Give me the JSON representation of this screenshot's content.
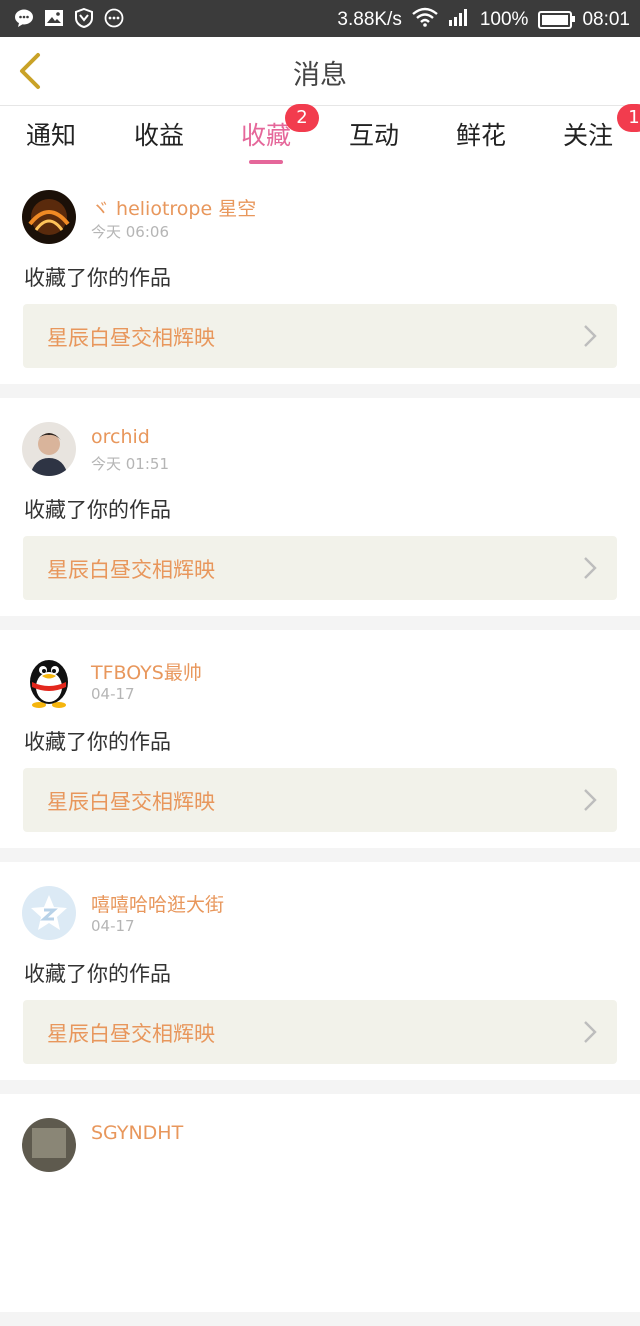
{
  "status_bar": {
    "speed": "3.88K/s",
    "battery": "100%",
    "battery_level": 1.0,
    "time": "08:01",
    "left_icons": [
      "chat-icon",
      "image-icon",
      "shield-icon",
      "more-circle-icon"
    ]
  },
  "header": {
    "title": "消息"
  },
  "tabs": [
    {
      "label": "通知",
      "badge": ""
    },
    {
      "label": "收益",
      "badge": ""
    },
    {
      "label": "收藏",
      "badge": "2",
      "active": true
    },
    {
      "label": "互动",
      "badge": ""
    },
    {
      "label": "鲜花",
      "badge": ""
    },
    {
      "label": "关注",
      "badge": "1"
    }
  ],
  "items": [
    {
      "user": "ヾ heliotrope 星空",
      "time": "今天 06:06",
      "action": "收藏了你的作品",
      "work": "星辰白昼交相辉映"
    },
    {
      "user": "orchid",
      "time": "今天 01:51",
      "action": "收藏了你的作品",
      "work": "星辰白昼交相辉映"
    },
    {
      "user": "TFBOYS最帅",
      "time": "04-17",
      "action": "收藏了你的作品",
      "work": "星辰白昼交相辉映"
    },
    {
      "user": "嘻嘻哈哈逛大街",
      "time": "04-17",
      "action": "收藏了你的作品",
      "work": "星辰白昼交相辉映"
    },
    {
      "user": "SGYNDHT"
    }
  ],
  "colors": {
    "accent": "#e5679a",
    "name": "#e8975c",
    "badge": "#f23c4e",
    "back_icon": "#c9a227"
  }
}
